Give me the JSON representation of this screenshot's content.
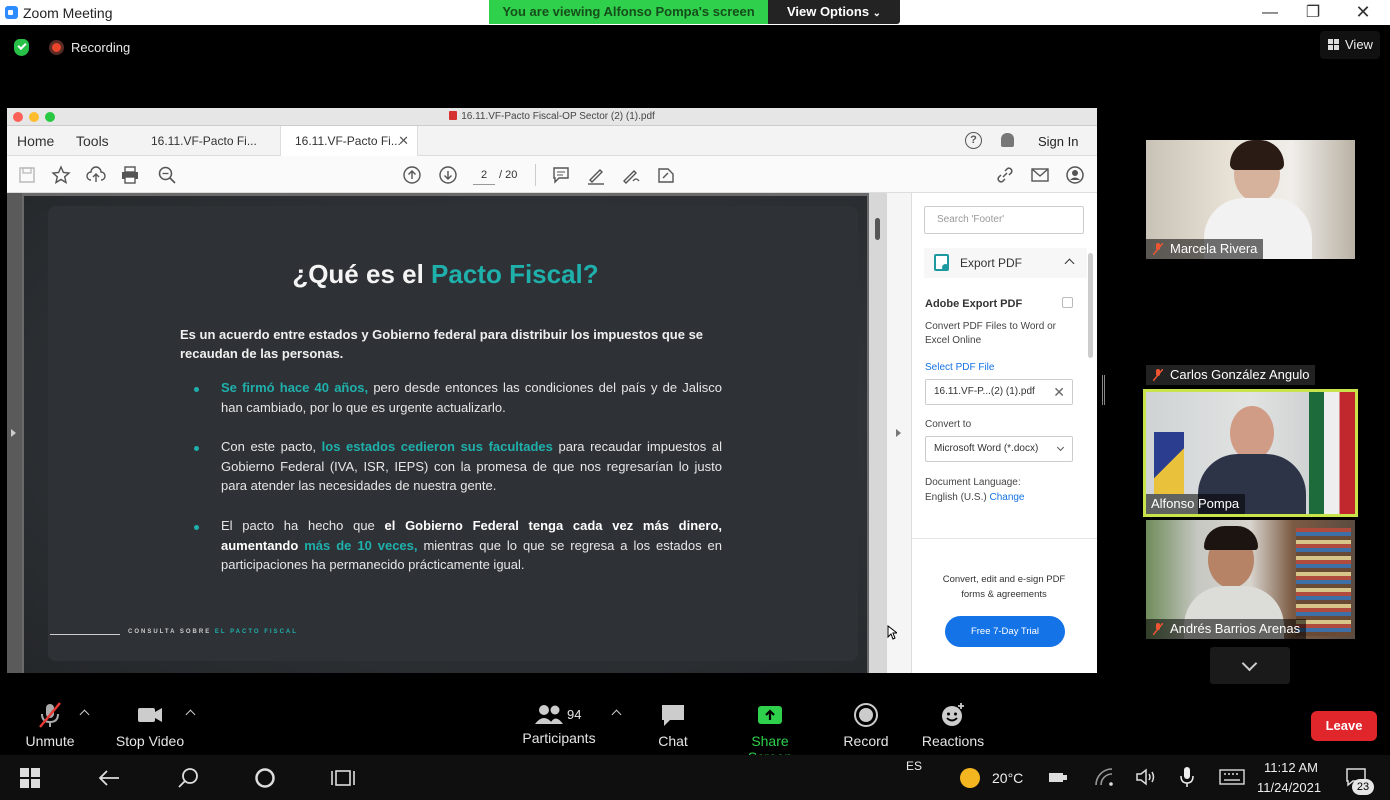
{
  "window": {
    "title": "Zoom Meeting"
  },
  "banner": {
    "viewing": "You are viewing Alfonso Pompa's screen",
    "view_options": "View Options"
  },
  "status": {
    "recording": "Recording",
    "view": "View"
  },
  "acrobat": {
    "file_title": "16.11.VF-Pacto Fiscal-OP Sector (2) (1).pdf",
    "home": "Home",
    "tools": "Tools",
    "tabs": [
      {
        "label": "16.11.VF-Pacto Fi..."
      },
      {
        "label": "16.11.VF-Pacto Fi..."
      }
    ],
    "sign_in": "Sign In",
    "page_current": "2",
    "page_total": "/ 20"
  },
  "slide": {
    "title_a": "¿Qué es el ",
    "title_b": "Pacto Fiscal?",
    "intro": "Es un acuerdo entre estados y Gobierno federal para distribuir los impuestos que se recaudan de las personas.",
    "bullet1_hl": "Se firmó hace 40 años,",
    "bullet1_rest": " pero desde entonces las condiciones del país y de Jalisco han cambiado, por lo que es urgente actualizarlo.",
    "bullet2_a": "Con este pacto, ",
    "bullet2_hl": "los estados cedieron sus facultades",
    "bullet2_rest": " para recaudar impuestos al Gobierno Federal (IVA, ISR, IEPS) con la promesa de que nos regresarían lo justo para atender las necesidades de nuestra gente.",
    "bullet3_a": "El pacto ha hecho que ",
    "bullet3_b": "el Gobierno Federal tenga cada vez más dinero, aumentando",
    "bullet3_hl": " más de 10 veces,",
    "bullet3_rest": " mientras que lo que se regresa a los estados en participaciones ha permanecido prácticamente igual.",
    "footer_a": "CONSULTA SOBRE ",
    "footer_b": "EL PACTO FISCAL"
  },
  "export_panel": {
    "search_placeholder": "Search 'Footer'",
    "header": "Export PDF",
    "title": "Adobe Export PDF",
    "desc": "Convert PDF Files to Word or Excel Online",
    "select_file": "Select PDF File",
    "file": "16.11.VF-P...(2) (1).pdf",
    "convert_to": "Convert to",
    "format": "Microsoft Word (*.docx)",
    "lang_label": "Document Language:",
    "lang_value": "English (U.S.)",
    "change": "Change",
    "promo": "Convert, edit and e-sign PDF forms & agreements",
    "trial": "Free 7-Day Trial"
  },
  "participants": [
    {
      "name": "Marcela Rivera"
    },
    {
      "name": "Carlos González Angulo"
    },
    {
      "name": "Alfonso Pompa"
    },
    {
      "name": "Andrés Barrios Arenas"
    }
  ],
  "controls": {
    "unmute": "Unmute",
    "stop_video": "Stop Video",
    "participants": "Participants",
    "participant_count": "94",
    "chat": "Chat",
    "share_screen": "Share Screen",
    "record": "Record",
    "reactions": "Reactions",
    "leave": "Leave"
  },
  "taskbar": {
    "lang": "ES",
    "temp": "20°C",
    "time": "11:12 AM",
    "date": "11/24/2021",
    "notifications": "23"
  },
  "colors": {
    "accent_teal": "#1fb0ac",
    "zoom_green": "#2fd04b",
    "leave_red": "#e0252b",
    "adobe_blue": "#1473e6",
    "speaker_border": "#c9e34b"
  }
}
